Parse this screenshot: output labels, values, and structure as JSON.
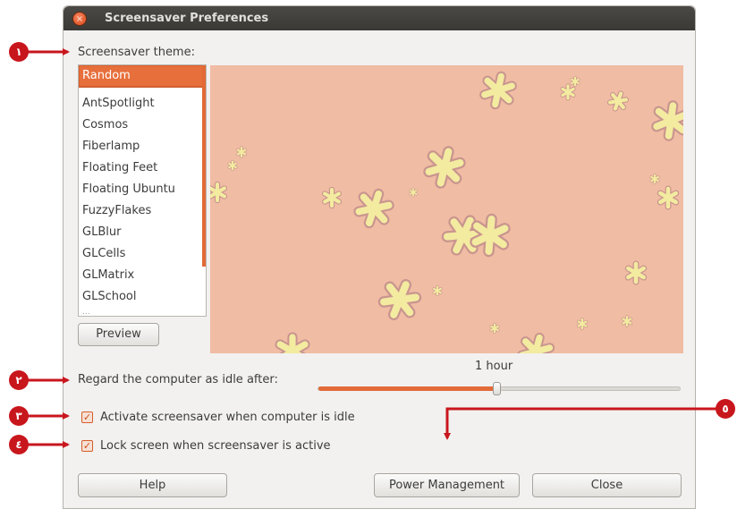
{
  "window": {
    "title": "Screensaver Preferences",
    "close_glyph": "×"
  },
  "theme": {
    "label": "Screensaver theme:",
    "items": [
      "Random",
      "AntSpotlight",
      "Cosmos",
      "Fiberlamp",
      "Floating Feet",
      "Floating Ubuntu",
      "FuzzyFlakes",
      "GLBlur",
      "GLCells",
      "GLMatrix",
      "GLSchool"
    ],
    "partial_item": "...",
    "selected": "Random"
  },
  "preview_button": "Preview",
  "idle": {
    "label": "Regard the computer as idle after:",
    "value": "1 hour",
    "slider_fraction": 0.49
  },
  "checks": [
    {
      "label": "Activate screensaver when computer is idle",
      "checked": true
    },
    {
      "label": "Lock screen when screensaver is active",
      "checked": true
    }
  ],
  "buttons": {
    "help": "Help",
    "power": "Power Management",
    "close": "Close"
  },
  "annotations": [
    "١",
    "٢",
    "٣",
    "٤",
    "٥"
  ],
  "colors": {
    "accent": "#e76f3c",
    "annotation": "#c8161d",
    "preview_bg": "#f0bca3",
    "flake": "#f3eba0"
  },
  "icons": {
    "check": "checkmark-icon",
    "close": "close-icon"
  }
}
